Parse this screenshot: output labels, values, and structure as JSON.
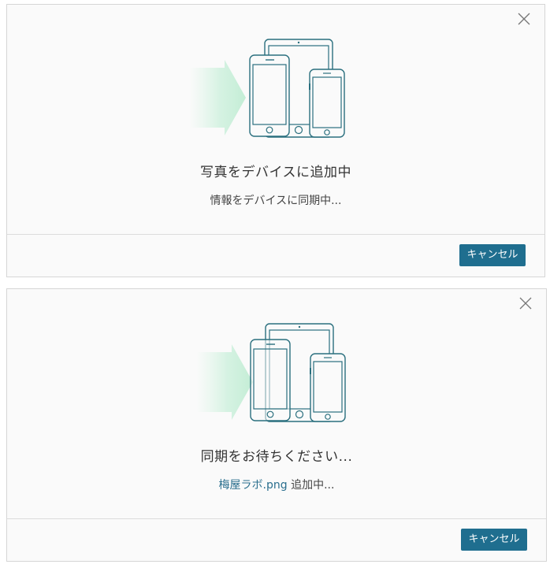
{
  "dialogs": [
    {
      "title": "写真をデバイスに追加中",
      "subtitle": "情報をデバイスに同期中...",
      "cancel_label": "キャンセル",
      "close_icon": "close-icon",
      "illustration_icon": "devices-sync-icon"
    },
    {
      "title": "同期をお待ちください...",
      "subtitle_file": "梅屋ラボ.png",
      "subtitle_rest": " 追加中...",
      "cancel_label": "キャンセル",
      "close_icon": "close-icon",
      "illustration_icon": "devices-sync-icon"
    }
  ],
  "colors": {
    "accent": "#1f6e8f",
    "device_stroke": "#2a6f7e",
    "arrow_green": "#c9efd9",
    "filename": "#2a6f8e"
  }
}
